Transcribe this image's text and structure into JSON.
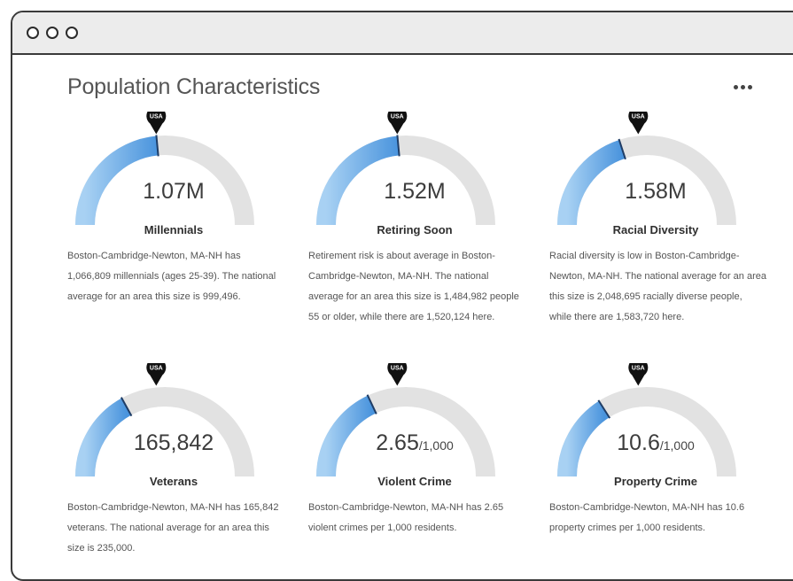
{
  "window": {
    "controls": [
      "close",
      "minimize",
      "maximize"
    ]
  },
  "page_title": "Population Characteristics",
  "more_menu_icon": "more-horizontal-icon",
  "marker_label": "USA",
  "colors": {
    "fill_start": "#a8d1f3",
    "fill_end": "#4a94dd",
    "track": "#e2e2e2",
    "marker": "#111111"
  },
  "cards": [
    {
      "value": "1.07M",
      "unit": "",
      "label": "Millennials",
      "fill_fraction": 0.47,
      "usa_fraction": 0.47,
      "description": "Boston-Cambridge-Newton, MA-NH has 1,066,809 millennials (ages 25-39). The national average for an area this size is 999,496."
    },
    {
      "value": "1.52M",
      "unit": "",
      "label": "Retiring Soon",
      "fill_fraction": 0.47,
      "usa_fraction": 0.47,
      "description": "Retirement risk is about average in Boston-Cambridge-Newton, MA-NH. The national average for an area this size is 1,484,982 people 55 or older, while there are 1,520,124 here."
    },
    {
      "value": "1.58M",
      "unit": "",
      "label": "Racial Diversity",
      "fill_fraction": 0.4,
      "usa_fraction": 0.47,
      "description": "Racial diversity is low in Boston-Cambridge-Newton, MA-NH. The national average for an area this size is 2,048,695 racially diverse people, while there are 1,583,720 here."
    },
    {
      "value": "165,842",
      "unit": "",
      "label": "Veterans",
      "fill_fraction": 0.34,
      "usa_fraction": 0.47,
      "description": "Boston-Cambridge-Newton, MA-NH has 165,842 veterans. The national average for an area this size is 235,000."
    },
    {
      "value": "2.65",
      "unit": "/1,000",
      "label": "Violent Crime",
      "fill_fraction": 0.36,
      "usa_fraction": 0.47,
      "description": "Boston-Cambridge-Newton, MA-NH has 2.65 violent crimes per 1,000 residents."
    },
    {
      "value": "10.6",
      "unit": "/1,000",
      "label": "Property Crime",
      "fill_fraction": 0.32,
      "usa_fraction": 0.47,
      "description": "Boston-Cambridge-Newton, MA-NH has 10.6 property crimes per 1,000 residents."
    }
  ]
}
